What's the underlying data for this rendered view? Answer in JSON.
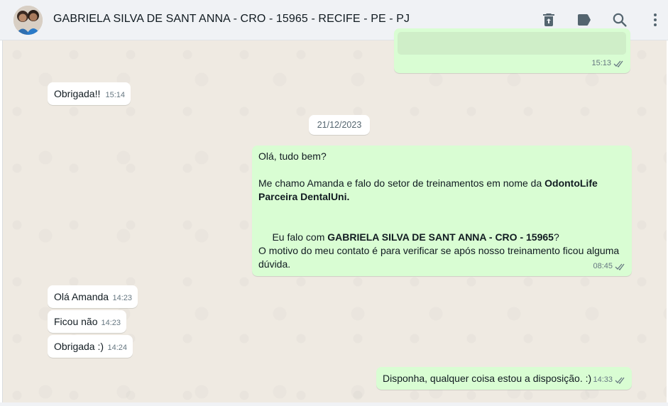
{
  "header": {
    "contact_name": "GABRIELA SILVA DE SANT ANNA - CRO - 15965 - RECIFE - PE - PJ",
    "icons": [
      "delete-icon",
      "label-icon",
      "search-icon",
      "menu-icon"
    ]
  },
  "messages": {
    "m1": {
      "direction": "out",
      "time": "15:13",
      "status": "read"
    },
    "m2": {
      "direction": "in",
      "text": "Obrigada!!",
      "time": "15:14"
    },
    "date": "21/12/2023",
    "m3": {
      "direction": "out",
      "line1": "Olá, tudo bem?",
      "line2_prefix": "Me chamo Amanda e falo do setor de treinamentos em nome da ",
      "line2_bold_a": "OdontoLife",
      "line2_bold_b": "Parceira DentalUni.",
      "line3_prefix": " Eu falo com ",
      "line3_bold": "GABRIELA SILVA DE SANT ANNA - CRO - 15965",
      "line3_suffix": "?",
      "line4a": "O motivo do meu contato é para verificar se após nosso treinamento ficou alguma",
      "line4b": "dúvida.",
      "time": "08:45",
      "status": "read"
    },
    "m4": {
      "direction": "in",
      "text": "Olá Amanda",
      "time": "14:23"
    },
    "m5": {
      "direction": "in",
      "text": "Ficou não",
      "time": "14:23"
    },
    "m6": {
      "direction": "in",
      "text": "Obrigada :)",
      "time": "14:24"
    },
    "m7": {
      "direction": "out",
      "text": "Disponha, qualquer coisa estou a disposição. :)",
      "time": "14:33",
      "status": "read"
    }
  },
  "colors": {
    "outgoing": "#d9fdd3",
    "incoming": "#ffffff",
    "background": "#efeae2",
    "header": "#f0f2f5"
  }
}
